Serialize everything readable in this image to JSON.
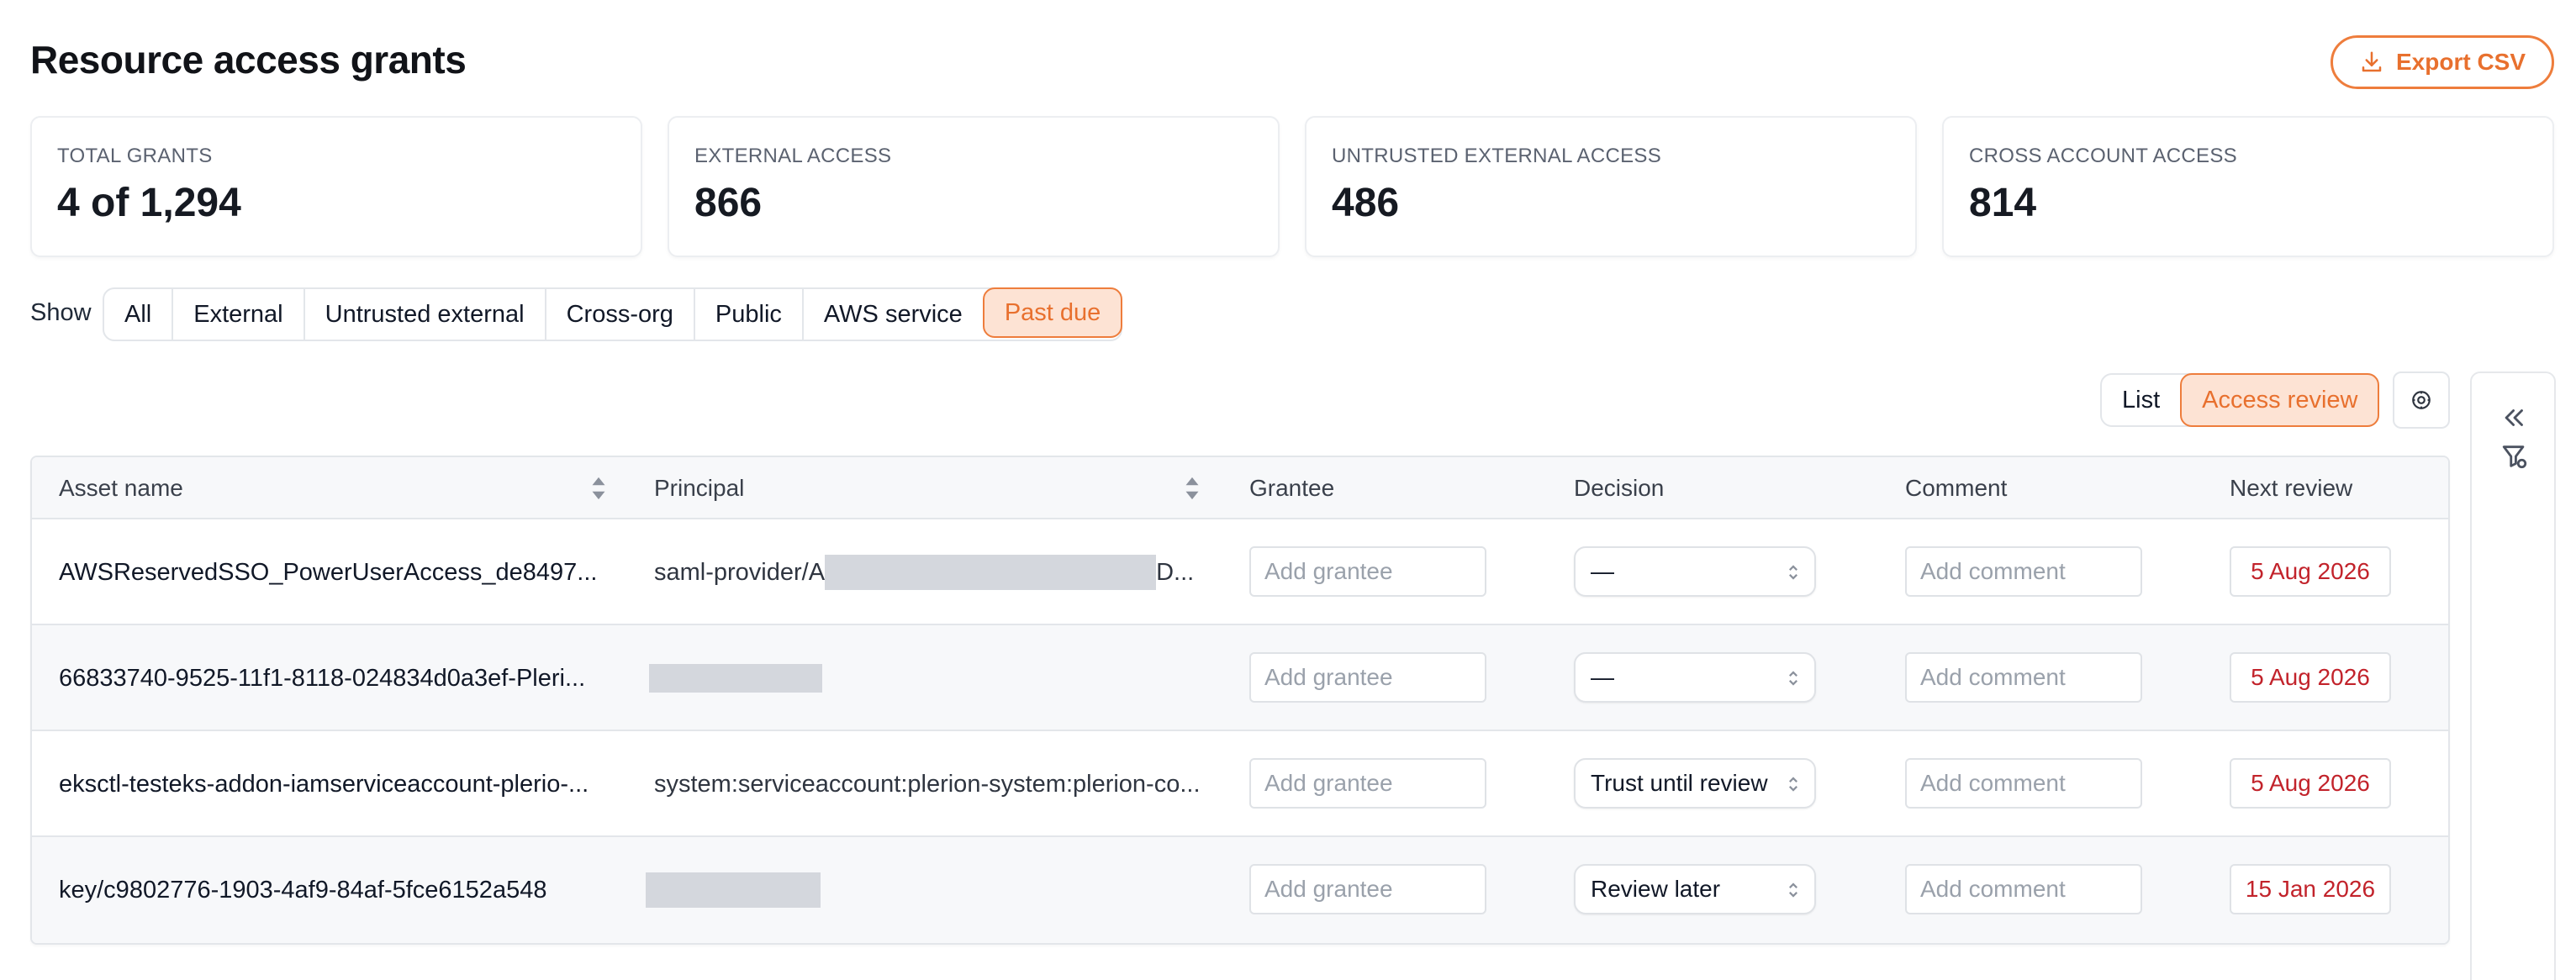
{
  "page": {
    "title": "Resource access grants"
  },
  "export": {
    "label": "Export CSV"
  },
  "stats": [
    {
      "label": "TOTAL GRANTS",
      "value": "4 of 1,294"
    },
    {
      "label": "EXTERNAL ACCESS",
      "value": "866"
    },
    {
      "label": "UNTRUSTED EXTERNAL ACCESS",
      "value": "486"
    },
    {
      "label": "CROSS ACCOUNT ACCESS",
      "value": "814"
    }
  ],
  "filters": {
    "label": "Show",
    "items": [
      "All",
      "External",
      "Untrusted external",
      "Cross-org",
      "Public",
      "AWS service",
      "Past due"
    ],
    "active": "Past due"
  },
  "view": {
    "items": [
      "List",
      "Access review"
    ],
    "active": "Access review"
  },
  "table": {
    "headers": [
      "Asset name",
      "Principal",
      "Grantee",
      "Decision",
      "Comment",
      "Next review"
    ],
    "grantee_placeholder": "Add grantee",
    "comment_placeholder": "Add comment",
    "rows": [
      {
        "asset": "AWSReservedSSO_PowerUserAccess_de8497...",
        "principal_prefix": "saml-provider/A",
        "principal_suffix": "D...",
        "decision": "—",
        "next_review": "5 Aug 2026"
      },
      {
        "asset": "66833740-9525-11f1-8118-024834d0a3ef-Pleri...",
        "principal_prefix": "",
        "principal_suffix": "",
        "decision": "—",
        "next_review": "5 Aug 2026"
      },
      {
        "asset": "eksctl-testeks-addon-iamserviceaccount-plerio-...",
        "principal_prefix": "system:serviceaccount:plerion-system:plerion-co...",
        "principal_suffix": "",
        "decision": "Trust until review",
        "next_review": "5 Aug 2026"
      },
      {
        "asset": "key/c9802776-1903-4af9-84af-5fce6152a548",
        "principal_prefix": "",
        "principal_suffix": "",
        "decision": "Review later",
        "next_review": "15 Jan 2026"
      }
    ]
  },
  "colors": {
    "accent": "#ee7d3c",
    "accent_bg": "#fde3d4",
    "due": "#c2232b",
    "border": "#e3e6ea"
  }
}
